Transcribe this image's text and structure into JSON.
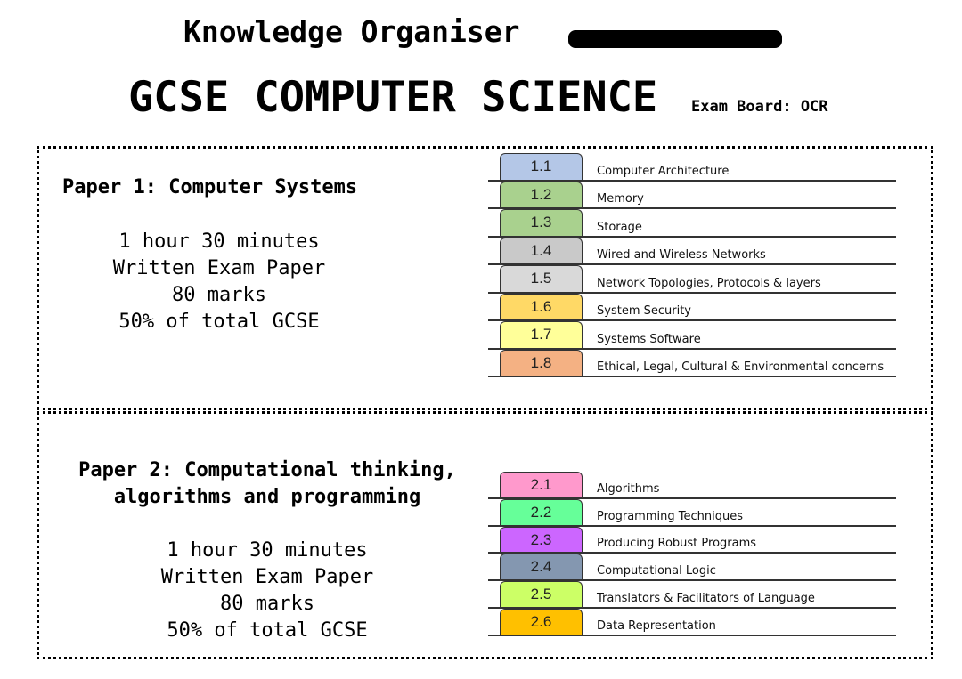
{
  "header": {
    "subtitle": "Knowledge Organiser",
    "title": "GCSE COMPUTER SCIENCE",
    "exam_board": "Exam Board: OCR"
  },
  "papers": [
    {
      "title": "Paper 1: Computer Systems",
      "details": [
        "1 hour 30 minutes",
        "Written Exam Paper",
        "80 marks",
        "50% of total GCSE"
      ],
      "topics": [
        {
          "code": "1.1",
          "label": "Computer Architecture",
          "color": "#b4c7e7"
        },
        {
          "code": "1.2",
          "label": "Memory",
          "color": "#a9d18e"
        },
        {
          "code": "1.3",
          "label": "Storage",
          "color": "#a9d18e"
        },
        {
          "code": "1.4",
          "label": "Wired and Wireless Networks",
          "color": "#c9c9c9"
        },
        {
          "code": "1.5",
          "label": "Network Topologies, Protocols & layers",
          "color": "#d9d9d9"
        },
        {
          "code": "1.6",
          "label": "System Security",
          "color": "#ffd966"
        },
        {
          "code": "1.7",
          "label": "Systems Software",
          "color": "#ffff99"
        },
        {
          "code": "1.8",
          "label": "Ethical, Legal, Cultural & Environmental concerns",
          "color": "#f4b183"
        }
      ]
    },
    {
      "title_lines": [
        "Paper 2: Computational thinking,",
        "algorithms and programming"
      ],
      "details": [
        "1 hour 30 minutes",
        "Written Exam Paper",
        "80 marks",
        "50% of total GCSE"
      ],
      "topics": [
        {
          "code": "2.1",
          "label": "Algorithms",
          "color": "#ff99cc"
        },
        {
          "code": "2.2",
          "label": "Programming Techniques",
          "color": "#66ff99"
        },
        {
          "code": "2.3",
          "label": "Producing Robust Programs",
          "color": "#cc66ff"
        },
        {
          "code": "2.4",
          "label": "Computational Logic",
          "color": "#8497b0"
        },
        {
          "code": "2.5",
          "label": "Translators & Facilitators of Language",
          "color": "#ccff66"
        },
        {
          "code": "2.6",
          "label": "Data Representation",
          "color": "#ffc000"
        }
      ]
    }
  ]
}
